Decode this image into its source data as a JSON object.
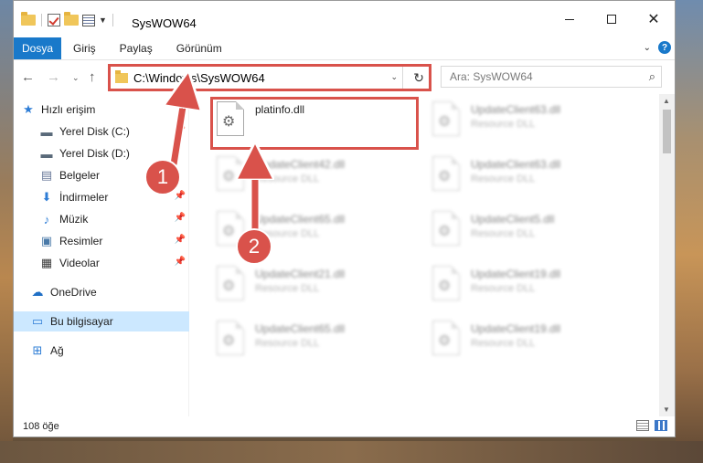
{
  "window": {
    "title": "SysWOW64"
  },
  "ribbon": {
    "tabs": [
      "Dosya",
      "Giriş",
      "Paylaş",
      "Görünüm"
    ]
  },
  "address": {
    "path": "C:\\Windows\\SysWOW64"
  },
  "search": {
    "placeholder": "Ara: SysWOW64"
  },
  "sidebar": {
    "items": [
      {
        "label": "Hızlı erişim",
        "icon": "star-icon"
      },
      {
        "label": "Yerel Disk (C:)",
        "icon": "drive-icon"
      },
      {
        "label": "Yerel Disk (D:)",
        "icon": "drive-icon"
      },
      {
        "label": "Belgeler",
        "icon": "documents-icon"
      },
      {
        "label": "İndirmeler",
        "icon": "download-icon"
      },
      {
        "label": "Müzik",
        "icon": "music-icon"
      },
      {
        "label": "Resimler",
        "icon": "pictures-icon"
      },
      {
        "label": "Videolar",
        "icon": "video-icon"
      },
      {
        "label": "OneDrive",
        "icon": "cloud-icon"
      },
      {
        "label": "Bu bilgisayar",
        "icon": "computer-icon"
      },
      {
        "label": "Ağ",
        "icon": "network-icon"
      }
    ]
  },
  "files": {
    "highlighted": {
      "name": "platinfo.dll"
    },
    "blurred": [
      {
        "name": "UpdateClient63.dll",
        "type": "Resource DLL"
      },
      {
        "name": "UpdateClient42.dll",
        "type": "Resource DLL"
      },
      {
        "name": "UpdateClient63.dll",
        "type": "Resource DLL"
      },
      {
        "name": "UpdateClient65.dll",
        "type": "Resource DLL"
      },
      {
        "name": "UpdateClient5.dll",
        "type": "Resource DLL"
      },
      {
        "name": "UpdateClient21.dll",
        "type": "Resource DLL"
      },
      {
        "name": "UpdateClient19.dll",
        "type": "Resource DLL"
      },
      {
        "name": "UpdateClient65.dll",
        "type": "Resource DLL"
      },
      {
        "name": "UpdateClient19.dll",
        "type": "Resource DLL"
      }
    ]
  },
  "status": {
    "count": "108 öğe"
  },
  "annotations": {
    "step1": "1",
    "step2": "2",
    "color": "#d9524b"
  }
}
